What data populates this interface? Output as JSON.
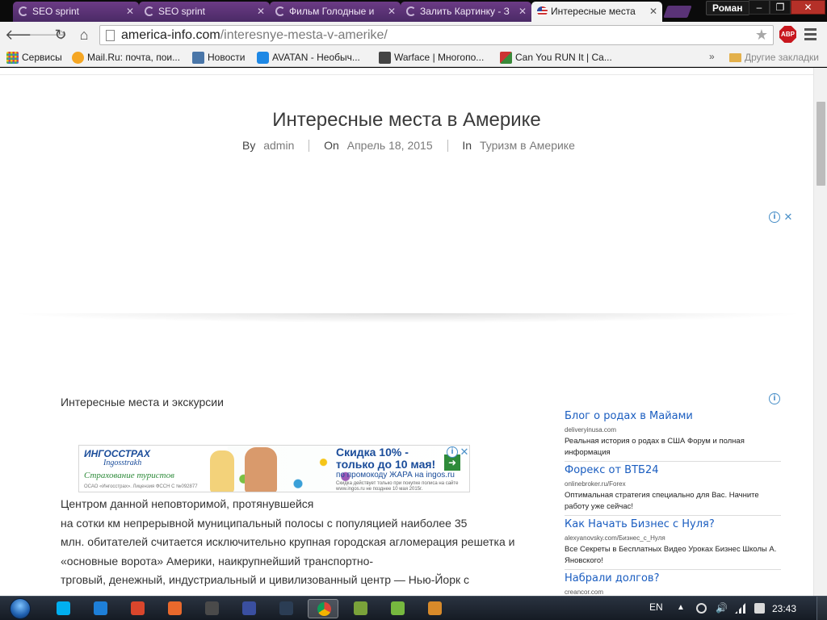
{
  "browser": {
    "tabs": [
      {
        "title": "SEO sprint",
        "loading": true,
        "active": false
      },
      {
        "title": "SEO sprint",
        "loading": true,
        "active": false
      },
      {
        "title": "Фильм Голодные и",
        "loading": true,
        "active": false
      },
      {
        "title": "Залить Картинку - З",
        "loading": true,
        "active": false
      },
      {
        "title": "Интересные места",
        "loading": false,
        "active": true
      }
    ],
    "profile_name": "Роман",
    "window_controls": {
      "minimize": "–",
      "maximize": "❐",
      "close": "✕"
    },
    "url": {
      "host": "america-info.com",
      "path": "/interesnye-mesta-v-amerike/"
    },
    "adblock_label": "ABP",
    "bookmarks": [
      {
        "label": "Сервисы",
        "icon": "apps-grid-icon",
        "color": "#d94545"
      },
      {
        "label": "Mail.Ru: почта, пои...",
        "icon": "mailru-icon",
        "color": "#f5a623"
      },
      {
        "label": "Новости",
        "icon": "vk-icon",
        "color": "#4a76a8"
      },
      {
        "label": "AVATAN - Необыч...",
        "icon": "avatan-icon",
        "color": "#1e88e5"
      },
      {
        "label": "Warface | Многопо...",
        "icon": "warface-icon",
        "color": "#333333"
      },
      {
        "label": "Can You RUN It | Ca...",
        "icon": "canyourunit-icon",
        "color": "#3a8a3a"
      }
    ],
    "bookmarks_more": "»",
    "other_bookmarks": "Другие закладки"
  },
  "page": {
    "title": "Интересные места в Америке",
    "meta": {
      "by_label": "By",
      "author": "admin",
      "on_label": "On",
      "date": "Апрель 18, 2015",
      "in_label": "In",
      "category": "Туризм в Америке"
    },
    "intro": "Интересные места и экскурсии",
    "banner": {
      "logo": "ИНГОССТРАХ",
      "script": "Ingosstrakh",
      "slogan": "Страхование туристов",
      "license": "ОСАО «Ингосстрах». Лицензия ФССН С №092877",
      "offer_line1": "Скидка 10% -",
      "offer_line2": "только до 10 мая!",
      "promo": "по промокоду ЖАРА на ingos.ru",
      "fine_print": "Скидка действует только при покупке полиса на сайте www.ingos.ru не позднее 10 мая 2015г."
    },
    "article_lines": [
      "Центром данной неповторимой, протянувшейся",
      "на сотки км непрерывной муниципальный полосы с популяцией наиболее 35",
      "млн. обитателей считается исключительно крупная городская агломерация решетка и",
      "«основные ворота» Америки, наикрупнейший транспортно-",
      "трговый, денежный, индустриальный и цивилизованный центр — Нью-Йорк с"
    ],
    "side_ads": [
      {
        "title": "Блог о родах в Майами",
        "url": "deliveryinusa.com",
        "desc": "Реальная история о родах в США Форум и полная информация"
      },
      {
        "title": "Форекс от ВТБ24",
        "url": "onlinebroker.ru/Forex",
        "desc": "Оптимальная стратегия специально для Вас. Начните работу уже сейчас!"
      },
      {
        "title": "Как Начать Бизнес с Нуля?",
        "url": "alexyanovsky.com/Бизнес_с_Нуля",
        "desc": "Все Секреты в Бесплатных Видео Уроках Бизнес Школы А. Яновского!"
      },
      {
        "title": "Набрали долгов?",
        "url": "creancor.com",
        "desc": ""
      }
    ]
  },
  "taskbar": {
    "apps": [
      {
        "name": "skype-icon",
        "color": "#00aff0",
        "active": false
      },
      {
        "name": "bolt-icon",
        "color": "#1e7fd8",
        "active": false
      },
      {
        "name": "ccleaner-icon",
        "color": "#d9462c",
        "active": false
      },
      {
        "name": "location-icon",
        "color": "#e9692c",
        "active": false
      },
      {
        "name": "terminal-icon",
        "color": "#4a4a4a",
        "active": false
      },
      {
        "name": "save-icon",
        "color": "#3a4fa0",
        "active": false
      },
      {
        "name": "steam-icon",
        "color": "#2b3d54",
        "active": false
      },
      {
        "name": "chrome-icon",
        "color": "#4caf50",
        "active": true
      },
      {
        "name": "camera-icon",
        "color": "#7aa23a",
        "active": false
      },
      {
        "name": "utorrent-icon",
        "color": "#76b83f",
        "active": false
      },
      {
        "name": "cube-icon",
        "color": "#d88a2a",
        "active": false
      }
    ],
    "language": "EN",
    "time": "23:43"
  }
}
